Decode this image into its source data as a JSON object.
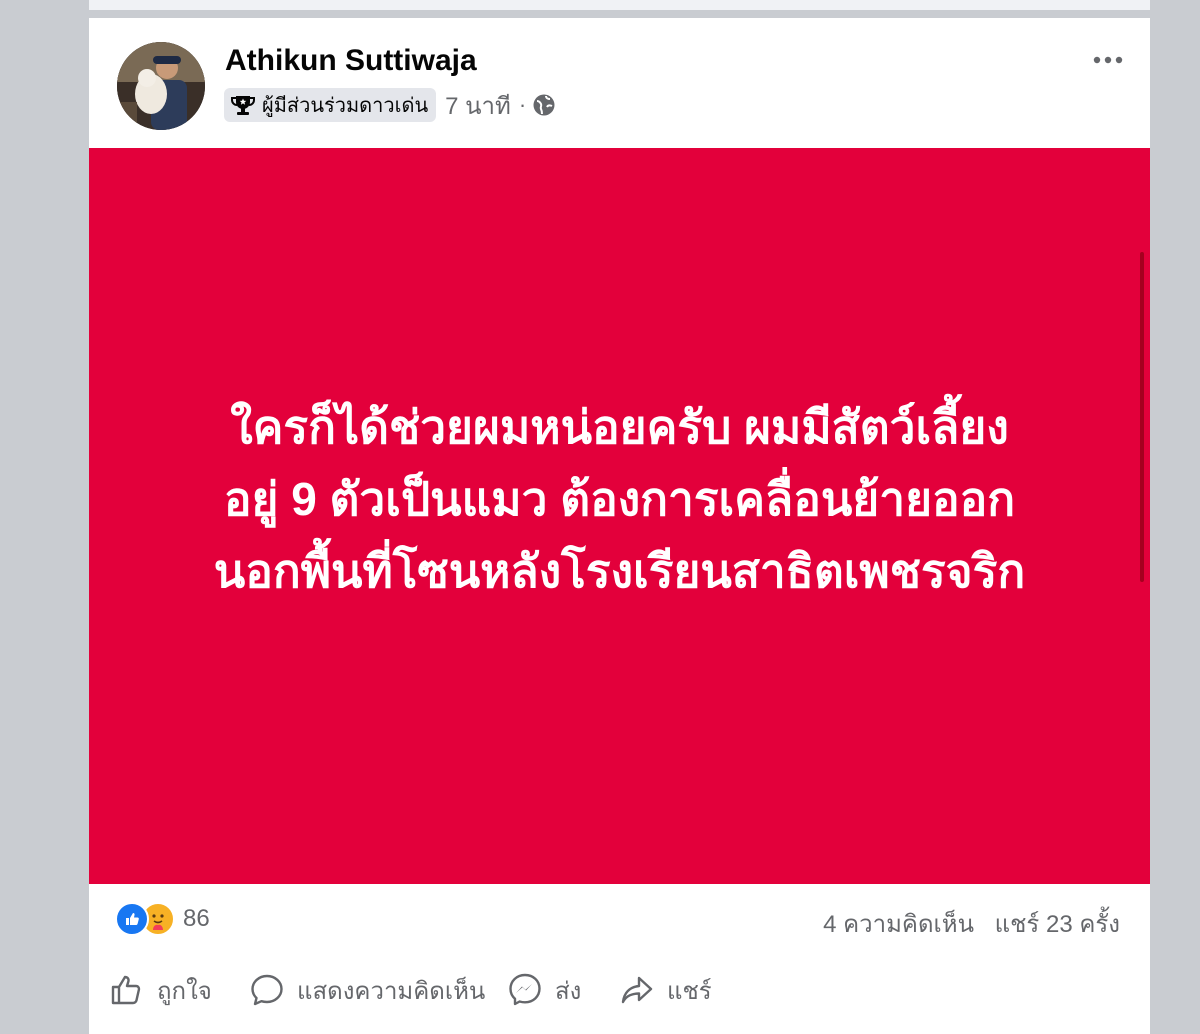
{
  "post": {
    "author_name": "Athikun Suttiwaja",
    "badge_label": "ผู้มีส่วนร่วมดาวเด่น",
    "time": "7 นาที",
    "audience_icon": "globe-icon",
    "text_lines": [
      "ใครก็ได้ช่วยผมหน่อยครับ ผมมีสัตว์เลี้ยง",
      "อยู่ 9 ตัวเป็นแมว ต้องการเคลื่อนย้ายออก",
      "นอกพื้นที่โซนหลังโรงเรียนสาธิตเพชรจริก"
    ],
    "background_color": "#e3003b",
    "reaction_count": "86",
    "comments_text": "4 ความคิดเห็น",
    "shares_text": "แชร์ 23 ครั้ง"
  },
  "actions": {
    "like_label": "ถูกใจ",
    "comment_label": "แสดงความคิดเห็น",
    "send_label": "ส่ง",
    "share_label": "แชร์"
  }
}
